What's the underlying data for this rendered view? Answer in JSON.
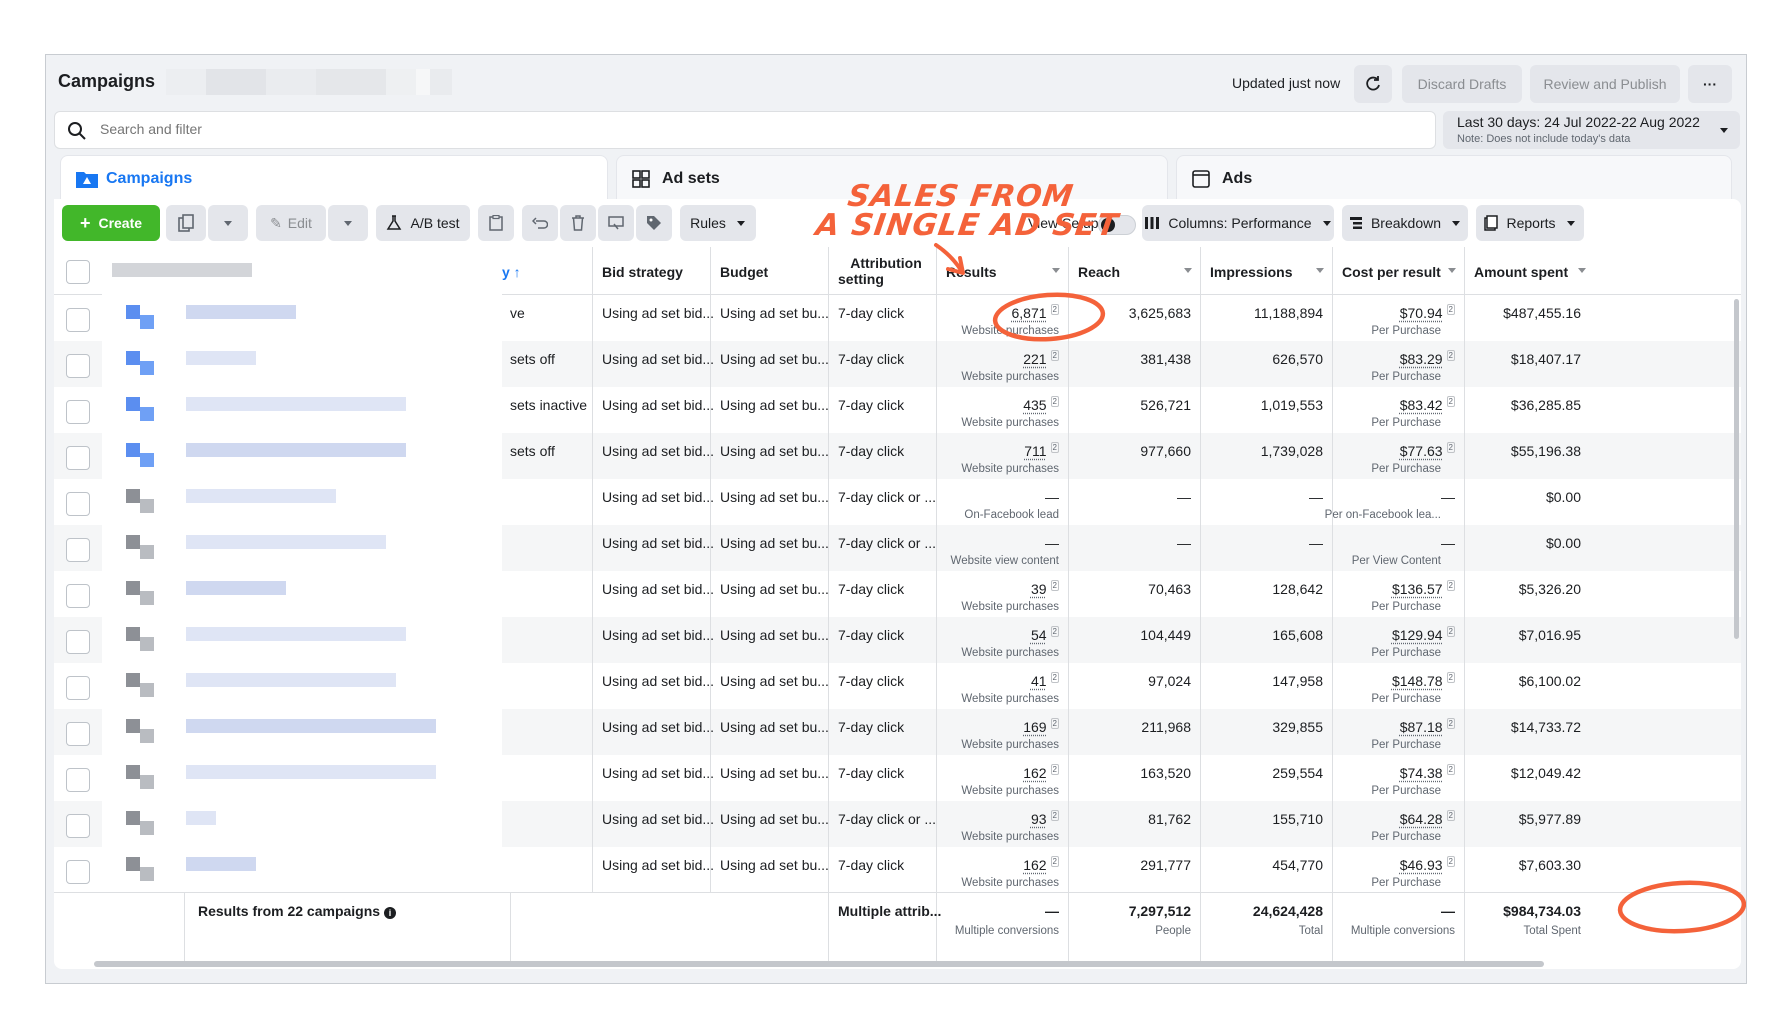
{
  "header": {
    "title": "Campaigns",
    "updated": "Updated just now",
    "discard": "Discard Drafts",
    "publish": "Review and Publish",
    "more": "···"
  },
  "search": {
    "placeholder": "Search and filter"
  },
  "date_range": {
    "label": "Last 30 days: 24 Jul 2022-22 Aug 2022",
    "note": "Note: Does not include today's data"
  },
  "level_tabs": [
    {
      "label": "Campaigns",
      "icon": "folder-icon"
    },
    {
      "label": "Ad sets",
      "icon": "grid-icon"
    },
    {
      "label": "Ads",
      "icon": "ad-icon"
    }
  ],
  "toolbar": {
    "create": "Create",
    "edit": "Edit",
    "ab_test": "A/B test",
    "rules": "Rules",
    "view_setup": "View Setup",
    "columns": "Columns: Performance",
    "breakdown": "Breakdown",
    "reports": "Reports"
  },
  "annotation": {
    "line1": "SALES FROM",
    "line2": "A SINGLE AD SET",
    "color": "#f4623a"
  },
  "columns": {
    "delivery": "y",
    "bid_strategy": "Bid strategy",
    "budget": "Budget",
    "attribution_1": "Attribution",
    "attribution_2": "setting",
    "results": "Results",
    "reach": "Reach",
    "impressions": "Impressions",
    "cost_per_result": "Cost per result",
    "amount_spent": "Amount spent"
  },
  "rows": [
    {
      "delivery": "ve",
      "bid": "Using ad set bid...",
      "budget": "Using ad set bu...",
      "attr": "7-day click",
      "results": "6,871",
      "results_sub": "Website purchases",
      "reach": "3,625,683",
      "impr": "11,188,894",
      "cpr": "$70.94",
      "cpr_sub": "Per Purchase",
      "spent": "$487,455.16"
    },
    {
      "delivery": "sets off",
      "bid": "Using ad set bid...",
      "budget": "Using ad set bu...",
      "attr": "7-day click",
      "results": "221",
      "results_sub": "Website purchases",
      "reach": "381,438",
      "impr": "626,570",
      "cpr": "$83.29",
      "cpr_sub": "Per Purchase",
      "spent": "$18,407.17"
    },
    {
      "delivery": "sets inactive",
      "bid": "Using ad set bid...",
      "budget": "Using ad set bu...",
      "attr": "7-day click",
      "results": "435",
      "results_sub": "Website purchases",
      "reach": "526,721",
      "impr": "1,019,553",
      "cpr": "$83.42",
      "cpr_sub": "Per Purchase",
      "spent": "$36,285.85"
    },
    {
      "delivery": "sets off",
      "bid": "Using ad set bid...",
      "budget": "Using ad set bu...",
      "attr": "7-day click",
      "results": "711",
      "results_sub": "Website purchases",
      "reach": "977,660",
      "impr": "1,739,028",
      "cpr": "$77.63",
      "cpr_sub": "Per Purchase",
      "spent": "$55,196.38"
    },
    {
      "delivery": "",
      "bid": "Using ad set bid...",
      "budget": "Using ad set bu...",
      "attr": "7-day click or ...",
      "results": "—",
      "results_sub": "On-Facebook lead",
      "reach": "—",
      "impr": "—",
      "cpr": "—",
      "cpr_sub": "Per on-Facebook lea...",
      "spent": "$0.00"
    },
    {
      "delivery": "",
      "bid": "Using ad set bid...",
      "budget": "Using ad set bu...",
      "attr": "7-day click or ...",
      "results": "—",
      "results_sub": "Website view content",
      "reach": "—",
      "impr": "—",
      "cpr": "—",
      "cpr_sub": "Per View Content",
      "spent": "$0.00"
    },
    {
      "delivery": "",
      "bid": "Using ad set bid...",
      "budget": "Using ad set bu...",
      "attr": "7-day click",
      "results": "39",
      "results_sub": "Website purchases",
      "reach": "70,463",
      "impr": "128,642",
      "cpr": "$136.57",
      "cpr_sub": "Per Purchase",
      "spent": "$5,326.20"
    },
    {
      "delivery": "",
      "bid": "Using ad set bid...",
      "budget": "Using ad set bu...",
      "attr": "7-day click",
      "results": "54",
      "results_sub": "Website purchases",
      "reach": "104,449",
      "impr": "165,608",
      "cpr": "$129.94",
      "cpr_sub": "Per Purchase",
      "spent": "$7,016.95"
    },
    {
      "delivery": "",
      "bid": "Using ad set bid...",
      "budget": "Using ad set bu...",
      "attr": "7-day click",
      "results": "41",
      "results_sub": "Website purchases",
      "reach": "97,024",
      "impr": "147,958",
      "cpr": "$148.78",
      "cpr_sub": "Per Purchase",
      "spent": "$6,100.02"
    },
    {
      "delivery": "",
      "bid": "Using ad set bid...",
      "budget": "Using ad set bu...",
      "attr": "7-day click",
      "results": "169",
      "results_sub": "Website purchases",
      "reach": "211,968",
      "impr": "329,855",
      "cpr": "$87.18",
      "cpr_sub": "Per Purchase",
      "spent": "$14,733.72"
    },
    {
      "delivery": "",
      "bid": "Using ad set bid...",
      "budget": "Using ad set bu...",
      "attr": "7-day click",
      "results": "162",
      "results_sub": "Website purchases",
      "reach": "163,520",
      "impr": "259,554",
      "cpr": "$74.38",
      "cpr_sub": "Per Purchase",
      "spent": "$12,049.42"
    },
    {
      "delivery": "",
      "bid": "Using ad set bid...",
      "budget": "Using ad set bu...",
      "attr": "7-day click or ...",
      "results": "93",
      "results_sub": "Website purchases",
      "reach": "81,762",
      "impr": "155,710",
      "cpr": "$64.28",
      "cpr_sub": "Per Purchase",
      "spent": "$5,977.89"
    },
    {
      "delivery": "",
      "bid": "Using ad set bid...",
      "budget": "Using ad set bu...",
      "attr": "7-day click",
      "results": "162",
      "results_sub": "Website purchases",
      "reach": "291,777",
      "impr": "454,770",
      "cpr": "$46.93",
      "cpr_sub": "Per Purchase",
      "spent": "$7,603.30"
    }
  ],
  "footer": {
    "label": "Results from 22 campaigns",
    "attr": "Multiple attrib...",
    "results": "—",
    "results_sub": "Multiple conversions",
    "reach": "7,297,512",
    "reach_sub": "People",
    "impr": "24,624,428",
    "impr_sub": "Total",
    "cpr": "—",
    "cpr_sub": "Multiple conversions",
    "spent": "$984,734.03",
    "spent_sub": "Total Spent"
  }
}
